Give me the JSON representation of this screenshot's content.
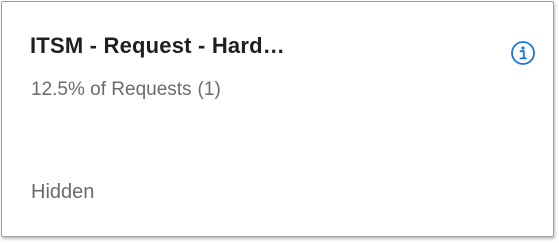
{
  "card": {
    "title": "ITSM - Request - Hard…",
    "percent_text": "12.5% of Requests",
    "count_text": "(1)",
    "status": "Hidden",
    "info_icon": "info-icon",
    "accent_color": "#1a73e8"
  }
}
